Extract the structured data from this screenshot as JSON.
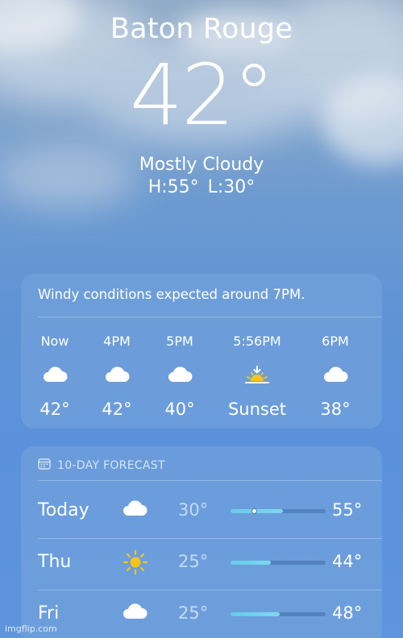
{
  "location": {
    "city": "Baton Rouge",
    "temperature": "42°",
    "condition": "Mostly Cloudy",
    "high_low": "H:55°  L:30°"
  },
  "hourly": {
    "alert": "Windy conditions expected around 7PM.",
    "items": [
      {
        "time": "Now",
        "icon": "cloud-icon",
        "temp": "42°"
      },
      {
        "time": "4PM",
        "icon": "cloud-icon",
        "temp": "42°"
      },
      {
        "time": "5PM",
        "icon": "cloud-icon",
        "temp": "40°"
      },
      {
        "time": "5:56PM",
        "icon": "sunset-icon",
        "temp": "Sunset"
      },
      {
        "time": "6PM",
        "icon": "cloud-icon",
        "temp": "38°"
      }
    ]
  },
  "forecast": {
    "header": "10-DAY FORECAST",
    "days": [
      {
        "day": "Today",
        "icon": "cloud-icon",
        "low": "30°",
        "high": "55°",
        "range_start": 0.0,
        "range_end": 0.55,
        "current": 0.25
      },
      {
        "day": "Thu",
        "icon": "sun-icon",
        "low": "25°",
        "high": "44°",
        "range_start": 0.0,
        "range_end": 0.42
      },
      {
        "day": "Fri",
        "icon": "cloud-icon",
        "low": "25°",
        "high": "48°",
        "range_start": 0.0,
        "range_end": 0.52
      }
    ]
  },
  "watermark": "imgflip.com",
  "colors": {
    "accent_bar": "#67cbe8",
    "sun": "#f5c518"
  }
}
